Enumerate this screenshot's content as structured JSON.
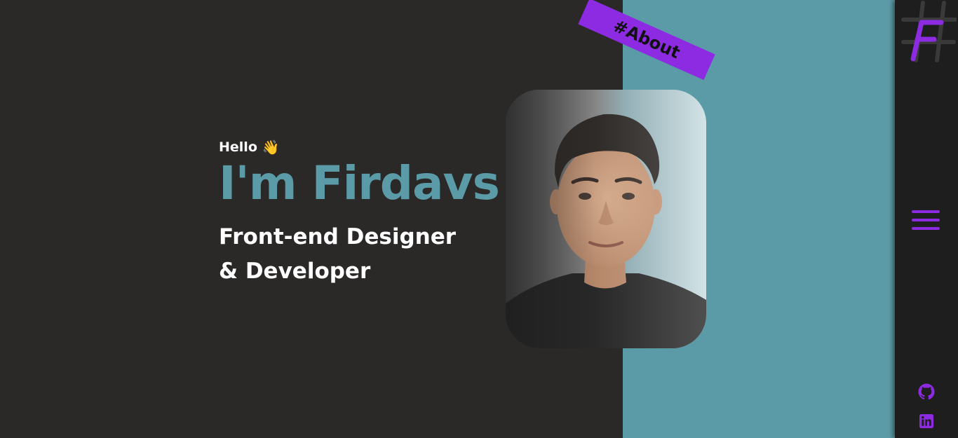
{
  "nav": {
    "section_tag": "#About",
    "logo_label": "F"
  },
  "hero": {
    "greeting": "Hello",
    "greeting_emoji": "👋",
    "name": "I'm Firdavs",
    "role_line1": "Front-end Designer",
    "role_line2": "& Developer"
  },
  "photo": {
    "alt": "Portrait photo"
  },
  "sidebar": {
    "icons": [
      "hash-logo-icon",
      "hamburger-menu-icon",
      "github-icon",
      "linkedin-icon"
    ]
  },
  "colors": {
    "background": "#2b2828",
    "teal": "#5b9ba7",
    "accent_purple": "#8d2be2",
    "sidebar": "#1f1e1e",
    "text": "#ffffff"
  }
}
